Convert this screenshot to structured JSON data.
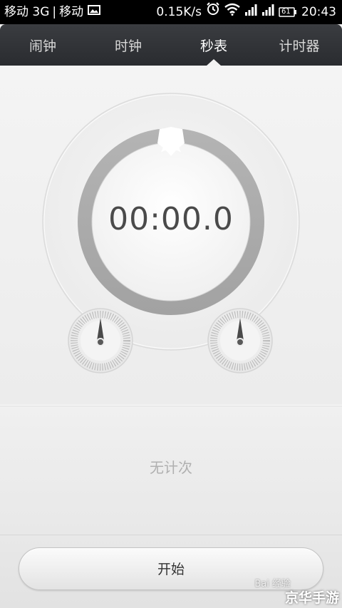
{
  "status_bar": {
    "carrier1": "移动 3G",
    "carrier2": "移动",
    "speed": "0.15K/s",
    "battery": "61",
    "time": "20:43"
  },
  "tabs": [
    {
      "label": "闹钟",
      "active": false
    },
    {
      "label": "时钟",
      "active": false
    },
    {
      "label": "秒表",
      "active": true
    },
    {
      "label": "计时器",
      "active": false
    }
  ],
  "stopwatch": {
    "time": "00:00.0"
  },
  "laps": {
    "empty_text": "无计次"
  },
  "controls": {
    "start_label": "开始"
  },
  "watermark": {
    "main": "京华手游",
    "sub": "Bai 经验"
  },
  "colors": {
    "tabbar": "#2e3034",
    "background": "#f2f2f2",
    "ring": "#a9a9a9"
  }
}
